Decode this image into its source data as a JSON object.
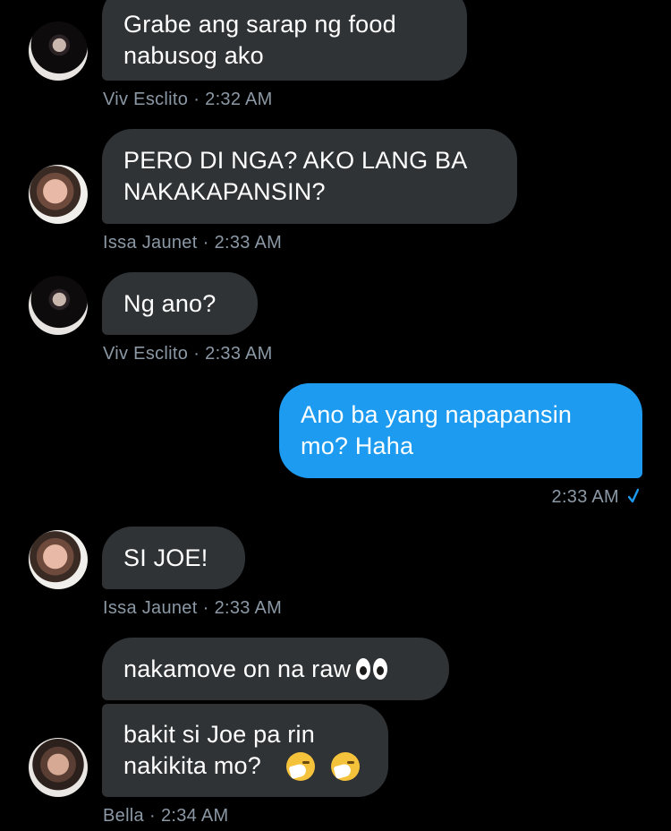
{
  "messages": [
    {
      "sender": "Viv Esclito",
      "text": "Grabe ang sarap ng food\nnabusog ako",
      "direction": "incoming",
      "avatar": "viv-avatar"
    },
    {
      "sender": "Issa Jaunet",
      "text": "PERO DI NGA? AKO LANG BA\nNAKAKAPANSIN?",
      "direction": "incoming",
      "avatar": "issa-avatar"
    },
    {
      "sender": "Viv Esclito",
      "text": "Ng ano?",
      "direction": "incoming",
      "avatar": "viv-avatar"
    },
    {
      "sender": "me",
      "text": "Ano ba yang napapansin\nmo? Haha",
      "direction": "outgoing"
    },
    {
      "sender": "Issa Jaunet",
      "text": "SI JOE!",
      "direction": "incoming",
      "avatar": "issa-avatar"
    },
    {
      "sender": "Bella",
      "text": "nakamove on na raw",
      "direction": "incoming",
      "emoji": "eyes-icon"
    },
    {
      "sender": "Bella",
      "text": "bakit si Joe pa rin\nnakikita mo?",
      "direction": "incoming",
      "emoji": "sneezing-face-icon",
      "avatar": "bella-avatar"
    }
  ],
  "meta": {
    "m1": {
      "name": "Viv Esclito",
      "sep": "·",
      "time": "2:32 AM"
    },
    "m2": {
      "name": "Issa Jaunet",
      "sep": "·",
      "time": "2:33 AM"
    },
    "m3": {
      "name": "Viv Esclito",
      "sep": "·",
      "time": "2:33 AM"
    },
    "m4": {
      "time": "2:33 AM",
      "status_icon": "check-icon"
    },
    "m5": {
      "name": "Issa Jaunet",
      "sep": "·",
      "time": "2:33 AM"
    },
    "m7": {
      "name": "Bella",
      "sep": "·",
      "time": "2:34 AM"
    }
  },
  "colors": {
    "background": "#000000",
    "incoming_bubble": "#2f3336",
    "outgoing_bubble": "#1d9bf0",
    "meta_text": "#8b98a5",
    "check": "#1d9bf0"
  }
}
